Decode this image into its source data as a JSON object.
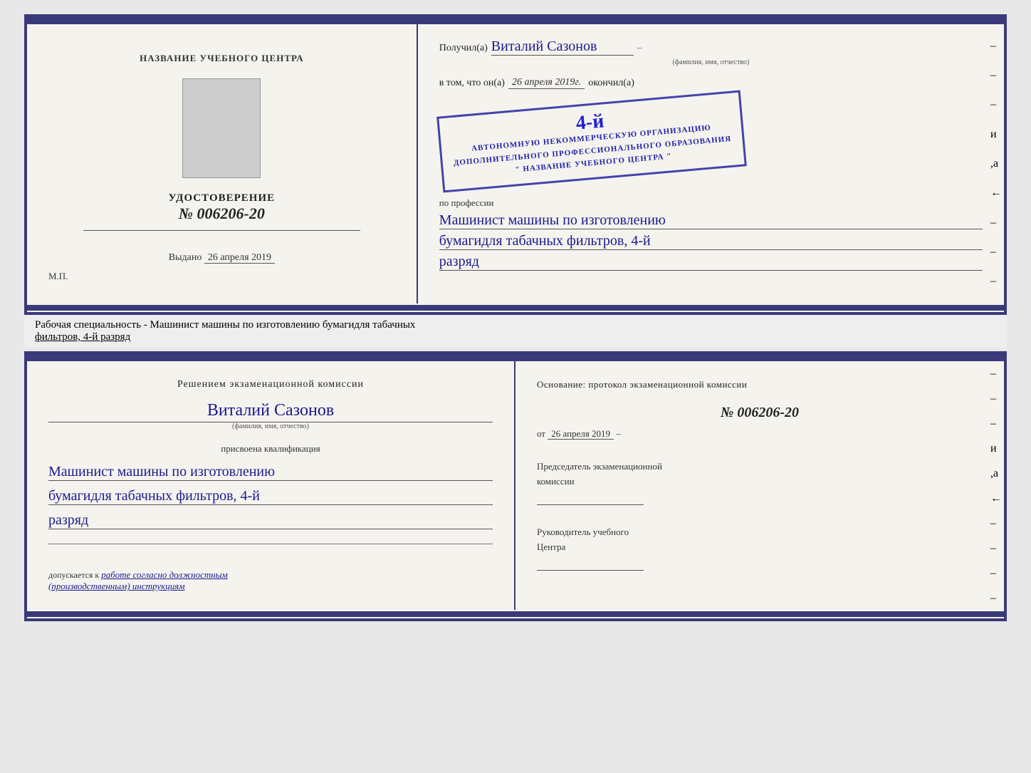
{
  "cert_top": {
    "left": {
      "center_title": "НАЗВАНИЕ УЧЕБНОГО ЦЕНТРА",
      "udost_label": "УДОСТОВЕРЕНИЕ",
      "udost_number": "№ 006206-20",
      "vydano_prefix": "Выдано",
      "vydano_date": "26 апреля 2019",
      "mp_label": "М.П."
    },
    "right": {
      "poluchil_prefix": "Получил(а)",
      "name_handwritten": "Виталий Сазонов",
      "fio_subtext": "(фамилия, имя, отчество)",
      "vtom_prefix": "в том, что он(а)",
      "date_handwritten": "26 апреля 2019г.",
      "okonchil_text": "окончил(а)",
      "stamp_line1": "АВТОНОМНУЮ НЕКОММЕРЧЕСКУЮ ОРГАНИЗАЦИЮ",
      "stamp_line2": "ДОПОЛНИТЕЛЬНОГО ПРОФЕССИОНАЛЬНОГО ОБРАЗОВАНИЯ",
      "stamp_line3": "\" НАЗВАНИЕ УЧЕБНОГО ЦЕНТРА \"",
      "stamp_number": "4-й",
      "po_professii": "по профессии",
      "profession_line1": "Машинист машины по изготовлению",
      "profession_line2": "бумагидля табачных фильтров, 4-й",
      "profession_line3": "разряд",
      "right_marks": [
        "–",
        "–",
        "–",
        "и",
        ",а",
        "←",
        "–",
        "–",
        "–"
      ]
    }
  },
  "separator": {
    "text": "Рабочая специальность - Машинист машины по изготовлению бумагидля табачных",
    "text2": "фильтров, 4-й разряд"
  },
  "cert_bottom": {
    "left": {
      "komissia_title": "Решением  экзаменационной  комиссии",
      "name_handwritten": "Виталий Сазонов",
      "fio_subtext": "(фамилия, имя, отчество)",
      "prisvoena": "присвоена квалификация",
      "kvalif_line1": "Машинист машины по изготовлению",
      "kvalif_line2": "бумагидля табачных фильтров, 4-й",
      "kvalif_line3": "разряд",
      "dopuskaetsya_prefix": "допускается к",
      "dopusk_text": "работе согласно должностным",
      "dopusk_text2": "(производственным) инструкциям"
    },
    "right": {
      "osnov_text": "Основание:  протокол  экзаменационной  комиссии",
      "protokol_number": "№  006206-20",
      "ot_prefix": "от",
      "ot_date": "26 апреля 2019",
      "predsedatel_label": "Председатель экзаменационной",
      "komissia_label": "комиссии",
      "ruk_label": "Руководитель учебного",
      "centr_label": "Центра",
      "right_marks": [
        "–",
        "–",
        "–",
        "–",
        "и",
        ",а",
        "←",
        "–",
        "–",
        "–",
        "–"
      ]
    }
  }
}
